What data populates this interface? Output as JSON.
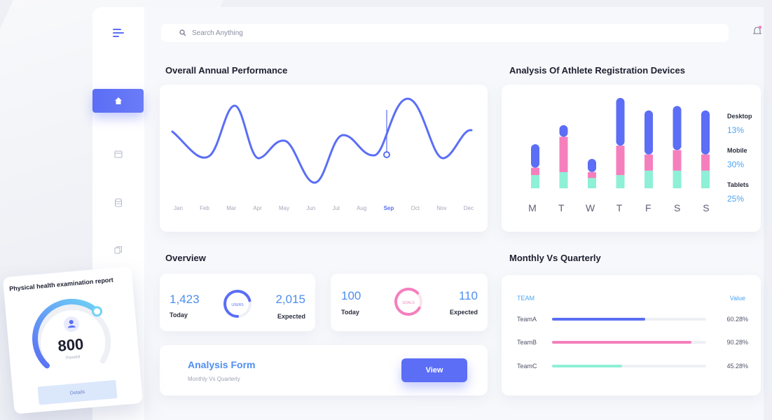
{
  "search": {
    "placeholder": "Search Anything"
  },
  "sections": {
    "performance_title": "Overall Annual Performance",
    "devices_title": "Analysis Of Athlete Registration Devices",
    "overview_title": "Overview",
    "monthly_title": "Monthly Vs Quarterly"
  },
  "performance": {
    "months": [
      "Jan",
      "Feb",
      "Mar",
      "Apr",
      "May",
      "Jun",
      "Jul",
      "Aug",
      "Sep",
      "Oct",
      "Nov",
      "Dec"
    ],
    "active_month": "Sep"
  },
  "chart_data": {
    "type": "bar",
    "categories": [
      "M",
      "T",
      "W",
      "T",
      "F",
      "S",
      "S"
    ],
    "series": [
      {
        "name": "Tablets",
        "color": "#8ef0d6",
        "values": [
          18,
          22,
          14,
          18,
          24,
          24,
          24
        ]
      },
      {
        "name": "Mobile",
        "color": "#f57fbd",
        "values": [
          10,
          48,
          8,
          40,
          22,
          28,
          22
        ]
      },
      {
        "name": "Desktop",
        "color": "#5b6ef5",
        "values": [
          32,
          16,
          18,
          65,
          60,
          60,
          60
        ]
      }
    ],
    "legend": [
      {
        "label": "Desktop",
        "value": "13%"
      },
      {
        "label": "Mobile",
        "value": "30%"
      },
      {
        "label": "Tablets",
        "value": "25%"
      }
    ]
  },
  "overview": {
    "users": {
      "today_value": "1,423",
      "today_label": "Today",
      "expected_value": "2,015",
      "expected_label": "Expected",
      "ring_label": "USERS"
    },
    "goals": {
      "today_value": "100",
      "today_label": "Today",
      "expected_value": "110",
      "expected_label": "Expected",
      "ring_label": "GOALS"
    }
  },
  "analysis_form": {
    "title": "Analysis Form",
    "subtitle": "Monthly Vs Quarterly",
    "button": "View"
  },
  "monthly": {
    "team_header": "TEAM",
    "value_header": "Value",
    "rows": [
      {
        "name": "TeamA",
        "value": "60.28%",
        "fraction": 0.6028,
        "color": "#5b6ef5"
      },
      {
        "name": "TeamB",
        "value": "90.28%",
        "fraction": 0.9028,
        "color": "#f57fbd"
      },
      {
        "name": "TeamC",
        "value": "45.28%",
        "fraction": 0.4528,
        "color": "#8ef0d6"
      }
    ]
  },
  "report": {
    "title": "Physical health examination report",
    "value": "800",
    "sublabel": "Passed",
    "button": "Details"
  },
  "colors": {
    "accent": "#5b6ef5",
    "pink": "#f57fbd",
    "mint": "#8ef0d6",
    "blue_text": "#4e8ef0"
  }
}
